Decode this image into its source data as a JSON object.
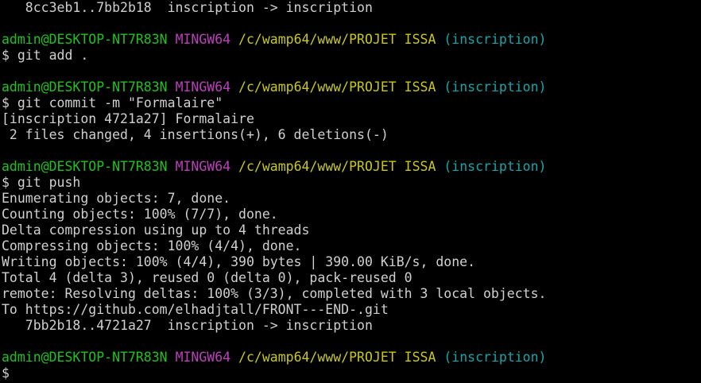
{
  "prompt": {
    "user_host": "admin@DESKTOP-NT7R83N",
    "system": "MINGW64",
    "path": "/c/wamp64/www/PROJET ISSA",
    "branch": "(inscription)",
    "symbol": "$"
  },
  "colors": {
    "background": "#000000",
    "user_host": "#1fc11f",
    "system": "#bc3fbc",
    "path": "#c8c81a",
    "branch": "#14a7a7",
    "output": "#d0d0d0"
  },
  "lines": {
    "l0": "   8cc3eb1..7bb2b18  inscription -> inscription",
    "cmd1": "git add .",
    "cmd2": "git commit -m \"Formalaire\"",
    "commit_out1": "[inscription 4721a27] Formalaire",
    "commit_out2": " 2 files changed, 4 insertions(+), 6 deletions(-)",
    "cmd3": "git push",
    "push1": "Enumerating objects: 7, done.",
    "push2": "Counting objects: 100% (7/7), done.",
    "push3": "Delta compression using up to 4 threads",
    "push4": "Compressing objects: 100% (4/4), done.",
    "push5": "Writing objects: 100% (4/4), 390 bytes | 390.00 KiB/s, done.",
    "push6": "Total 4 (delta 3), reused 0 (delta 0), pack-reused 0",
    "push7": "remote: Resolving deltas: 100% (3/3), completed with 3 local objects.",
    "push8": "To https://github.com/elhadjtall/FRONT---END-.git",
    "push9": "   7bb2b18..4721a27  inscription -> inscription",
    "final": "$"
  }
}
